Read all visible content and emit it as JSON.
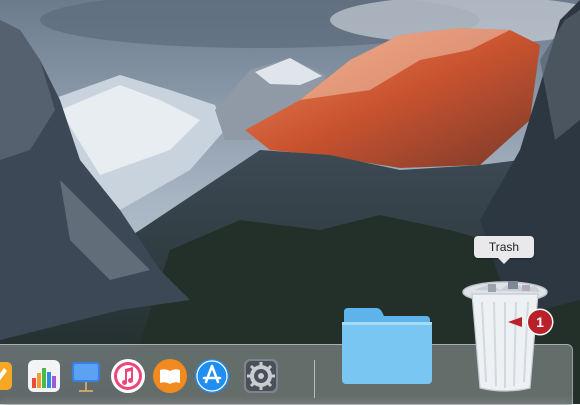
{
  "trash": {
    "tooltip": "Trash"
  },
  "callout": {
    "number": "1"
  },
  "dock": {
    "items": [
      {
        "icon": "pages-icon"
      },
      {
        "icon": "numbers-icon"
      },
      {
        "icon": "keynote-icon"
      },
      {
        "icon": "itunes-icon"
      },
      {
        "icon": "ibooks-icon"
      },
      {
        "icon": "app-store-icon"
      },
      {
        "icon": "system-preferences-icon"
      },
      {
        "icon": "folder-icon"
      },
      {
        "icon": "trash-icon"
      }
    ]
  },
  "colors": {
    "callout": "#b8202a",
    "folder": "#79c6f2",
    "app_store": "#1f8ef0",
    "itunes": "#f0457a",
    "ibooks": "#f18a1f"
  }
}
